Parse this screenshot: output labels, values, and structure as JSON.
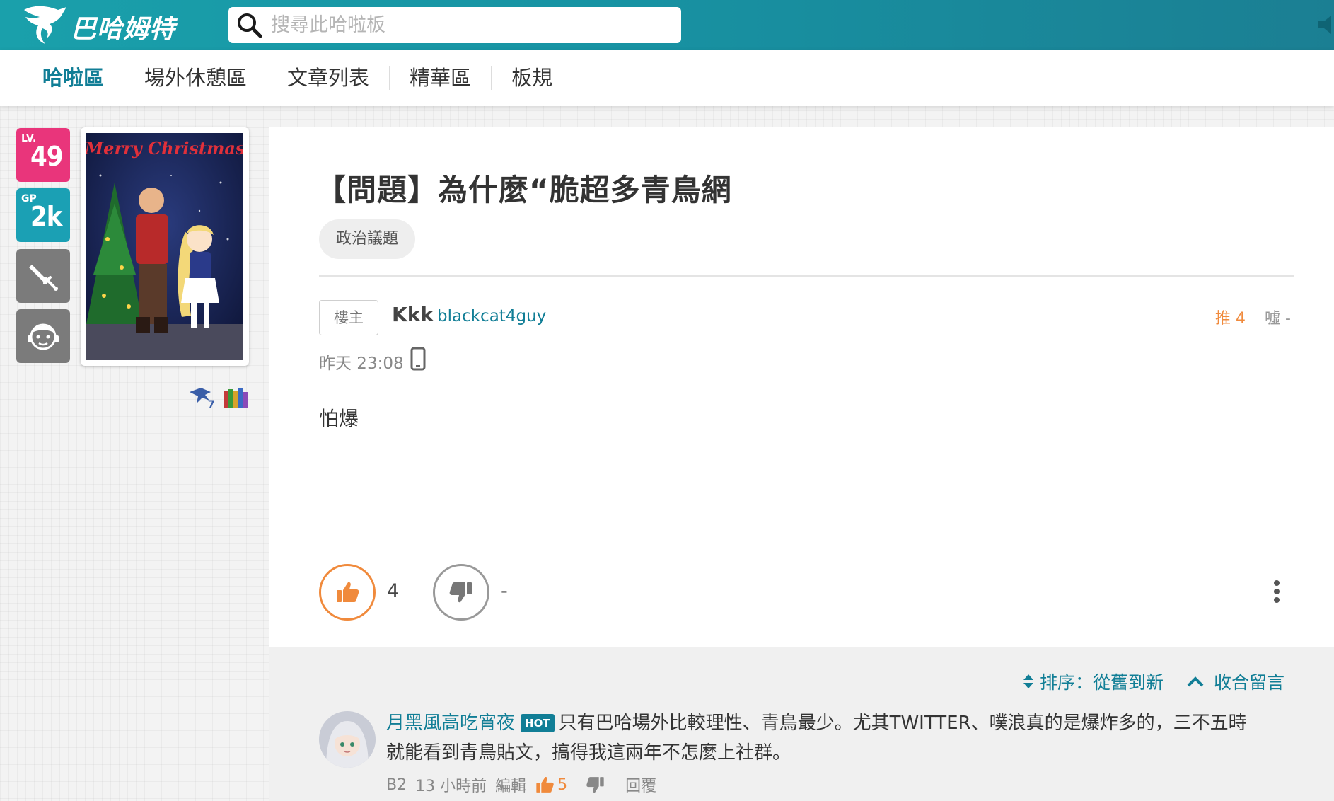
{
  "header": {
    "logo_text": "巴哈姆特",
    "search_placeholder": "搜尋此哈啦板"
  },
  "subnav": {
    "items": [
      {
        "label": "哈啦區",
        "active": true
      },
      {
        "label": "場外休憩區",
        "active": false
      },
      {
        "label": "文章列表",
        "active": false
      },
      {
        "label": "精華區",
        "active": false
      },
      {
        "label": "板規",
        "active": false
      }
    ]
  },
  "user_panel": {
    "lv_label": "LV.",
    "lv_value": "49",
    "gp_label": "GP",
    "gp_value": "2k",
    "avatar_banner": "Merry Christmas"
  },
  "post": {
    "title": "【問題】為什麼“脆超多青鳥網",
    "tag": "政治議題",
    "floor_label": "樓主",
    "author_name": "Kkk",
    "author_id": "blackcat4guy",
    "push_stat": "推 4",
    "boo_stat": "噓 -",
    "time": "昨天 23:08",
    "body": "怕爆",
    "gp_count": "4",
    "bp_count": "-"
  },
  "comments": {
    "sort_label": "排序：從舊到新",
    "collapse_label": "收合留言",
    "items": [
      {
        "user": "月黑風高吃宵夜",
        "hot_badge": "HOT",
        "text": "只有巴哈場外比較理性、青鳥最少。尤其TWITTER、噗浪真的是爆炸多的，三不五時就能看到青鳥貼文，搞得我這兩年不怎麼上社群。",
        "floor": "B2",
        "time": "13 小時前",
        "edit_label": "編輯",
        "gp": "5",
        "reply_label": "回覆"
      }
    ]
  },
  "colors": {
    "brand_teal": "#1793a3",
    "link_teal": "#117e96",
    "push_orange": "#f08a3c",
    "lv_pink": "#e9357b",
    "gp_cyan": "#1ba0b4"
  }
}
